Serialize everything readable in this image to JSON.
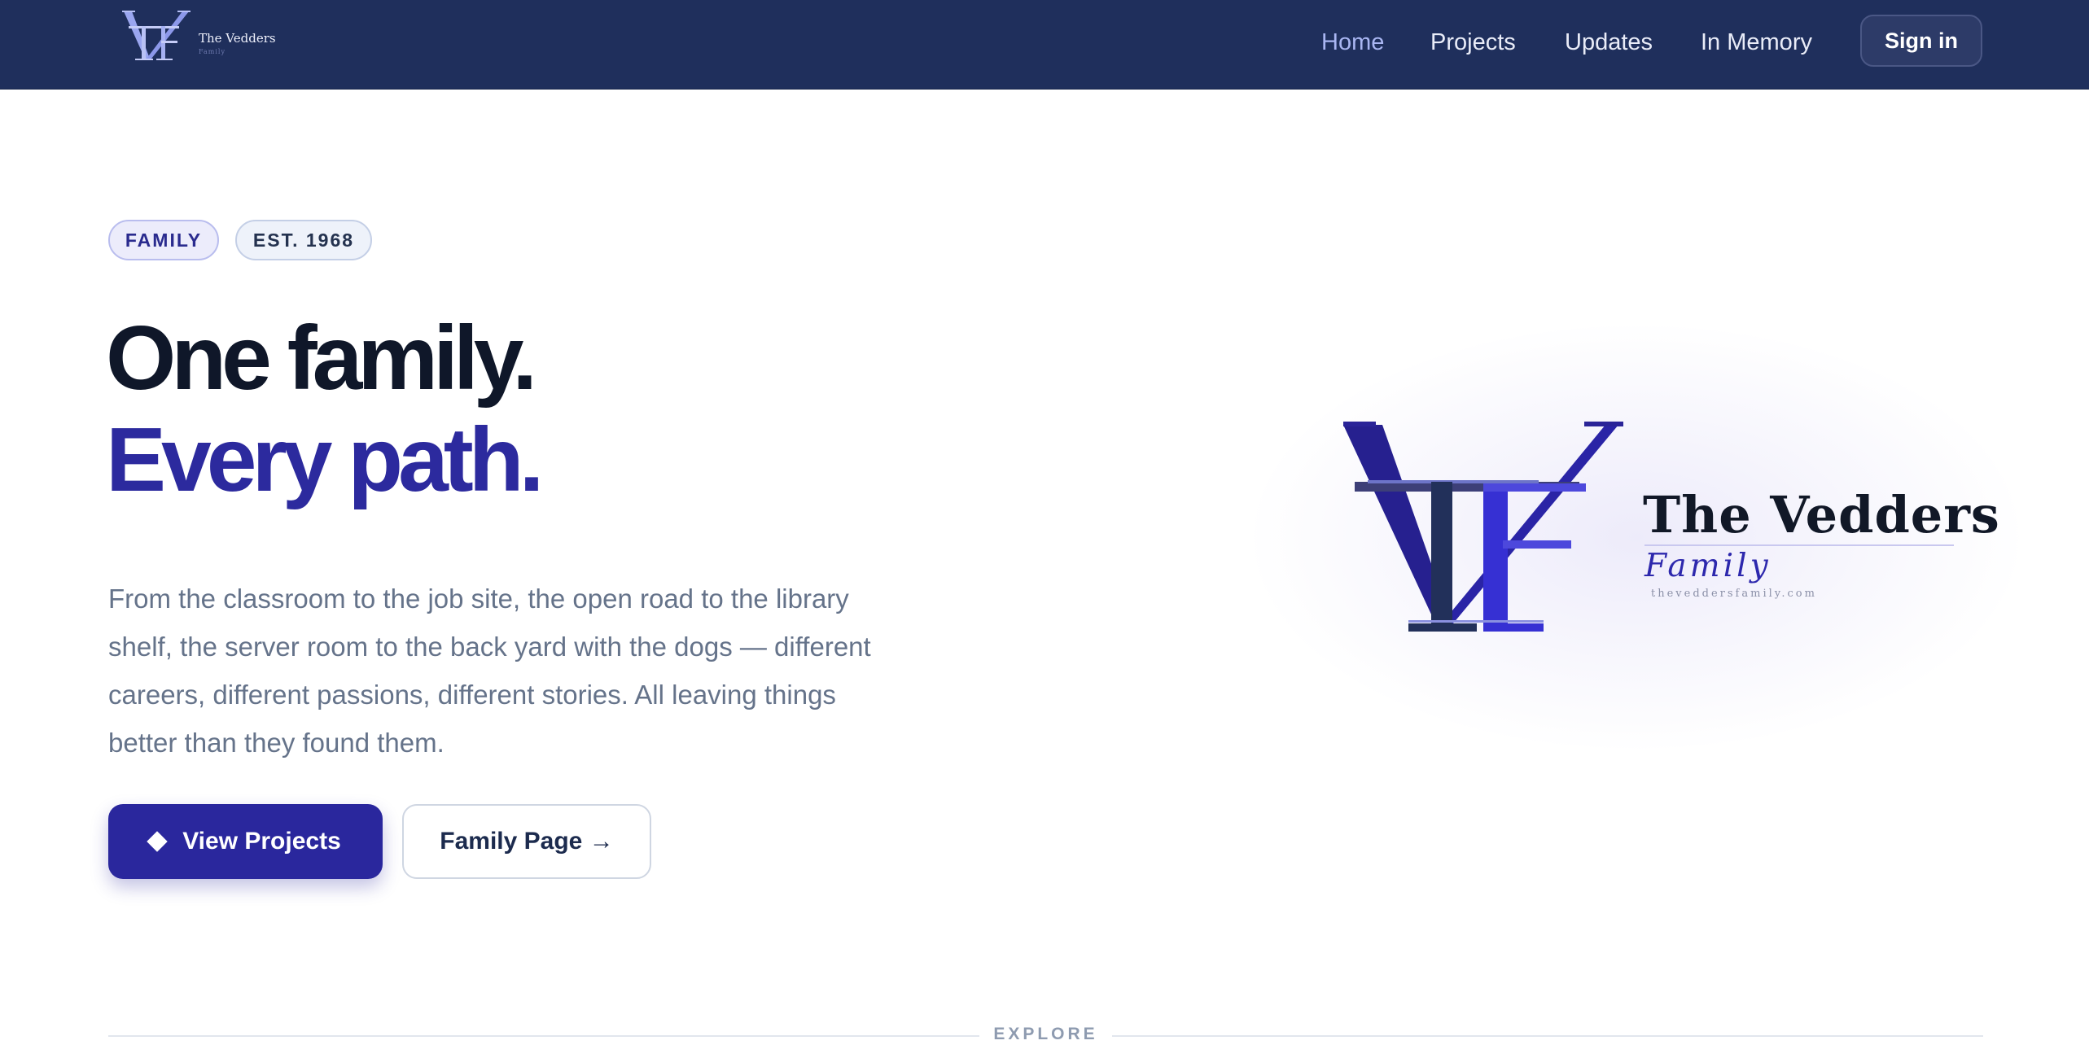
{
  "header": {
    "brand_name": "The Vedders",
    "brand_sub": "Family",
    "nav": [
      {
        "label": "Home",
        "active": true
      },
      {
        "label": "Projects",
        "active": false
      },
      {
        "label": "Updates",
        "active": false
      },
      {
        "label": "In Memory",
        "active": false
      }
    ],
    "signin_label": "Sign in"
  },
  "hero": {
    "badges": [
      "FAMILY",
      "EST. 1968"
    ],
    "headline_line1": "One family.",
    "headline_line2": "Every path.",
    "lede": "From the classroom to the job site, the open road to the library shelf, the server room to the back yard with the dogs — different careers, different passions, different stories. All leaving things better than they found them.",
    "primary_cta": "View Projects",
    "primary_icon": "diamond-icon",
    "secondary_cta": "Family Page →"
  },
  "logo": {
    "title": "The Vedders",
    "subtitle": "Family",
    "url": "theveddersfamily.com"
  },
  "explore_label": "EXPLORE",
  "colors": {
    "header_bg": "#1f2f5c",
    "accent": "#2c2a9e",
    "heading": "#0f1729",
    "body_text": "#65738a"
  }
}
